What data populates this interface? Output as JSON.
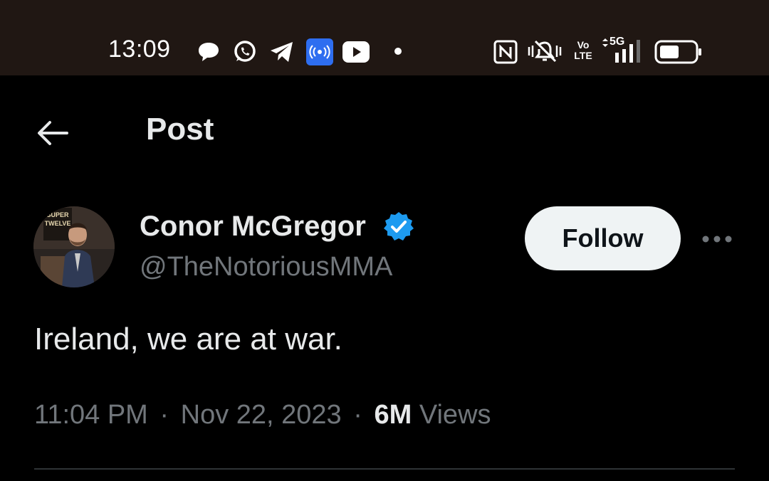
{
  "status_bar": {
    "time": "13:09",
    "notification_icons": [
      "chat-bubble-icon",
      "whatsapp-icon",
      "telegram-icon",
      "broadcast-icon",
      "youtube-icon",
      "dot-icon"
    ],
    "system_icons": [
      "nfc-icon",
      "vibrate-off-icon",
      "volte-icon",
      "5g-signal-icon",
      "battery-icon"
    ],
    "volte_label": "Vo LTE",
    "network_label": "5G",
    "broadcast_color": "#2e6ef0"
  },
  "header": {
    "back_icon": "arrow-left-icon",
    "title": "Post"
  },
  "post": {
    "author_name": "Conor McGregor",
    "verified_color": "#1d9bf0",
    "handle": "@TheNotoriousMMA",
    "follow_label": "Follow",
    "more_icon": "more-horizontal-icon",
    "text": "Ireland, we are at war.",
    "time": "11:04 PM",
    "separator": "·",
    "date": "Nov 22, 2023",
    "views_count": "6M",
    "views_label": "Views"
  },
  "avatar_sign_text": "SUPER TWELVE"
}
